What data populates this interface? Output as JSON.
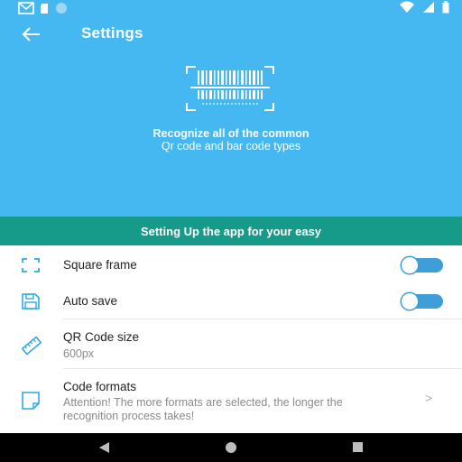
{
  "colors": {
    "header_bg": "#45B8F1",
    "banner_bg": "#169A8A",
    "accent": "#3E9FD8",
    "icon_blue": "#2FA8E6"
  },
  "statusbar": {
    "left_icons": [
      "gmail-icon",
      "sd-card-icon",
      "sync-dot-icon"
    ],
    "right_icons": [
      "wifi-icon",
      "signal-icon",
      "battery-icon"
    ]
  },
  "header": {
    "title": "Settings",
    "back_icon": "arrow-left-icon",
    "hero_icon": "barcode-scan-icon",
    "tagline_line1": "Recognize all of the common",
    "tagline_line2": "Qr code and bar code types"
  },
  "banner": {
    "text": "Setting Up the app for your easy"
  },
  "settings": {
    "square_frame": {
      "label": "Square frame",
      "icon": "square-frame-icon",
      "toggle": "off"
    },
    "auto_save": {
      "label": "Auto save",
      "icon": "save-disk-icon",
      "toggle": "off"
    },
    "qr_size": {
      "label": "QR Code size",
      "value": "600px",
      "icon": "ruler-icon"
    },
    "code_formats": {
      "label": "Code formats",
      "description": "Attention! The more formats are selected, the longer the recognition process takes!",
      "icon": "note-icon",
      "chevron": ">"
    }
  },
  "navbar": {
    "icons": [
      "nav-back-icon",
      "nav-home-icon",
      "nav-recents-icon"
    ]
  }
}
